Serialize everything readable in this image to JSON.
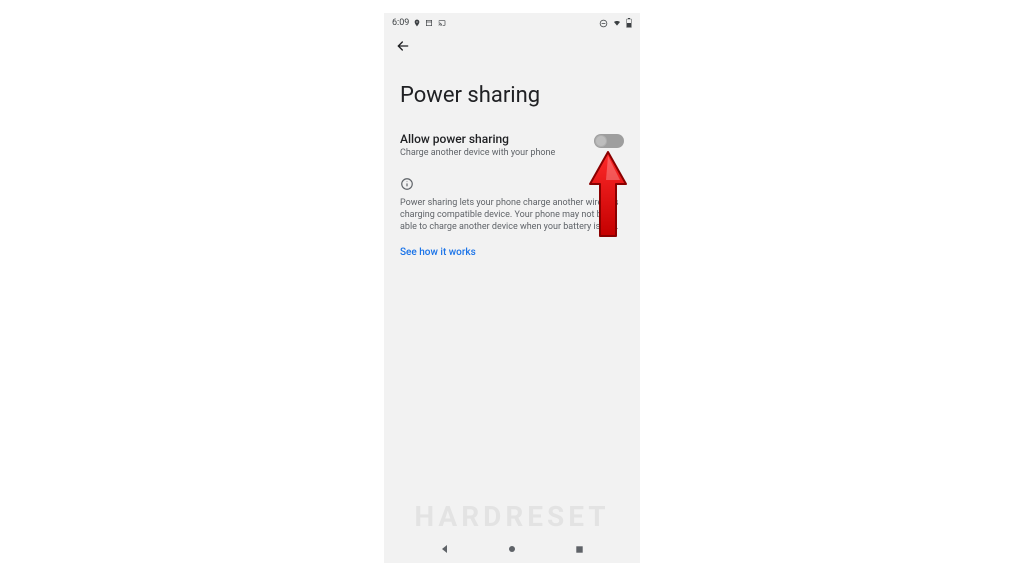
{
  "status": {
    "time": "6:09",
    "left_icons": [
      "location-icon",
      "calendar-icon",
      "cast-icon"
    ],
    "right_icons": [
      "dnd-icon",
      "wifi-icon",
      "battery-icon"
    ]
  },
  "page": {
    "title": "Power sharing"
  },
  "setting": {
    "title": "Allow power sharing",
    "subtitle": "Charge another device with your phone",
    "enabled": false
  },
  "info": {
    "text": "Power sharing lets your phone charge another wireless charging compatible device. Your phone may not be able to charge another device when your battery is low."
  },
  "link": {
    "label": "See how it works"
  },
  "watermark": "HARDRESET",
  "nav": {
    "back": "back",
    "home": "home",
    "recent": "recent"
  }
}
